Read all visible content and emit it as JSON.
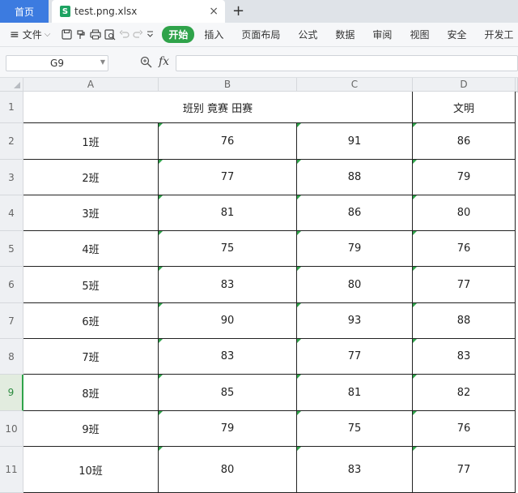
{
  "tabs": {
    "home_label": "首页",
    "file_icon_letter": "S",
    "file_label": "test.png.xlsx",
    "close_glyph": "×",
    "add_glyph": "+"
  },
  "toolbar": {
    "file_menu_label": "文件",
    "active_tab_label": "开始",
    "ribbon_tabs": [
      "插入",
      "页面布局",
      "公式",
      "数据",
      "审阅",
      "视图",
      "安全",
      "开发工"
    ]
  },
  "formula_bar": {
    "name_box_value": "G9",
    "fx_label": "fx",
    "formula_value": ""
  },
  "grid": {
    "columns": [
      "A",
      "B",
      "C",
      "D"
    ],
    "rows": [
      "1",
      "2",
      "3",
      "4",
      "5",
      "6",
      "7",
      "8",
      "9",
      "10",
      "11"
    ],
    "selected_row": "9",
    "header": {
      "merged_title": "班别 竟赛 田赛",
      "d_header": "文明"
    },
    "data": [
      [
        "1班",
        "76",
        "91",
        "86"
      ],
      [
        "2班",
        "77",
        "88",
        "79"
      ],
      [
        "3班",
        "81",
        "86",
        "80"
      ],
      [
        "4班",
        "75",
        "79",
        "76"
      ],
      [
        "5班",
        "83",
        "80",
        "77"
      ],
      [
        "6班",
        "90",
        "93",
        "88"
      ],
      [
        "7班",
        "83",
        "77",
        "83"
      ],
      [
        "8班",
        "85",
        "81",
        "82"
      ],
      [
        "9班",
        "79",
        "75",
        "76"
      ],
      [
        "10班",
        "80",
        "83",
        "77"
      ]
    ]
  },
  "colors": {
    "home_tab": "#3c7be0",
    "active_green": "#2fa34a",
    "excel_green": "#1ea362"
  }
}
